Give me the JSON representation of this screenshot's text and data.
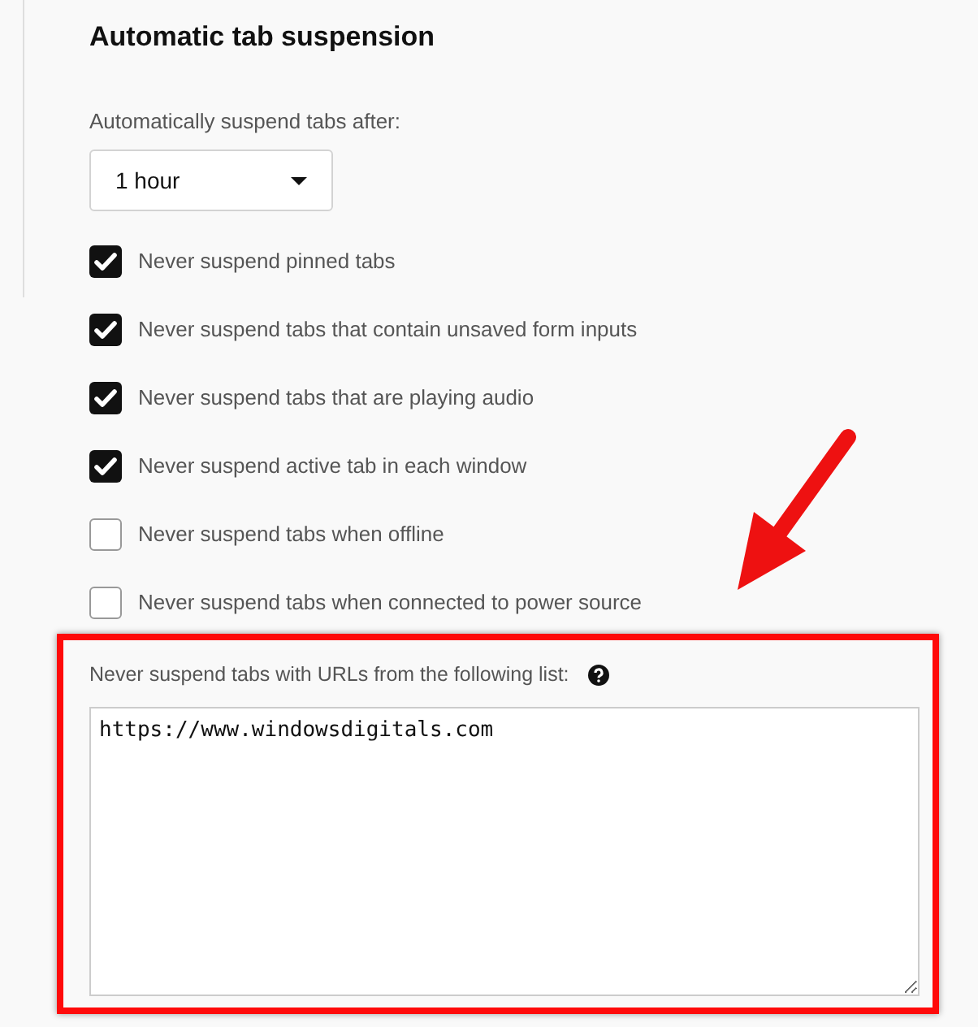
{
  "section": {
    "title": "Automatic tab suspension"
  },
  "suspend_after": {
    "label": "Automatically suspend tabs after:",
    "value": "1 hour"
  },
  "options": [
    {
      "label": "Never suspend pinned tabs",
      "checked": true
    },
    {
      "label": "Never suspend tabs that contain unsaved form inputs",
      "checked": true
    },
    {
      "label": "Never suspend tabs that are playing audio",
      "checked": true
    },
    {
      "label": "Never suspend active tab in each window",
      "checked": true
    },
    {
      "label": "Never suspend tabs when offline",
      "checked": false
    },
    {
      "label": "Never suspend tabs when connected to power source",
      "checked": false
    }
  ],
  "whitelist": {
    "label": "Never suspend tabs with URLs from the following list:",
    "value": "https://www.windowsdigitals.com"
  }
}
